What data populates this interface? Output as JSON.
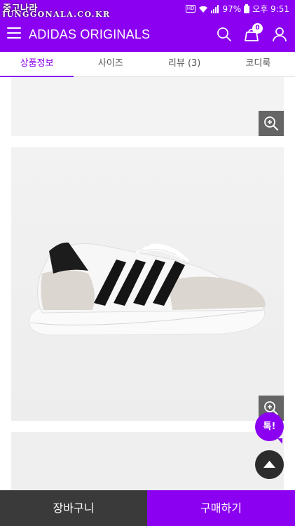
{
  "status_bar": {
    "watermark_top": "중고나라",
    "watermark_bottom": "JUNGGONALA.CO.KR",
    "hd_label": "HD",
    "battery": "97%",
    "time": "오후 9:51"
  },
  "header": {
    "title": "ADIDAS ORIGINALS",
    "cart_count": "0",
    "menu_icon": "hamburger-icon",
    "search_icon": "search-icon",
    "cart_icon": "cart-icon",
    "user_icon": "user-icon"
  },
  "tabs": [
    {
      "label": "상품정보",
      "active": true
    },
    {
      "label": "사이즈",
      "active": false
    },
    {
      "label": "리뷰 (3)",
      "active": false
    },
    {
      "label": "코디룩",
      "active": false
    }
  ],
  "floating": {
    "talk_label": "톡!",
    "top_icon": "scroll-top-icon"
  },
  "bottom_bar": {
    "cart_label": "장바구니",
    "buy_label": "구매하기"
  },
  "colors": {
    "accent": "#8b00f0",
    "dark_button": "#3a3a3a",
    "zoom_button": "#464646"
  }
}
